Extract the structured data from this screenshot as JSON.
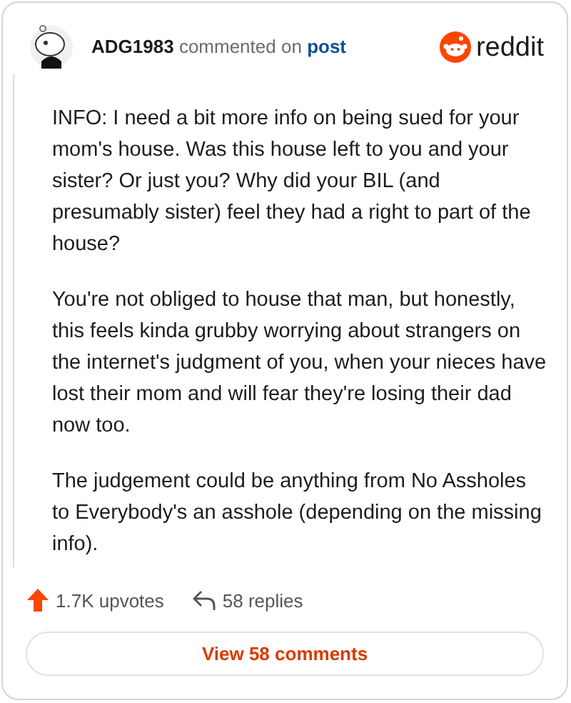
{
  "comment": {
    "author": "ADG1983",
    "action": "commented on",
    "target": "post",
    "brand": "reddit",
    "paragraphs": [
      "INFO: I need a bit more info on being sued for your mom's house. Was this house left to you and your sister? Or just you? Why did your BIL (and presumably sister) feel they had a right to part of the house?",
      "You're not obliged to house that man, but honestly, this feels kinda grubby worrying about strangers on the internet's judgment of you, when your nieces have lost their mom and will fear they're losing their dad now too.",
      "The judgement could be anything from No Assholes to Everybody's an asshole (depending on the missing info)."
    ]
  },
  "footer": {
    "upvotes": "1.7K upvotes",
    "replies": "58 replies",
    "button": "View 58 comments"
  }
}
